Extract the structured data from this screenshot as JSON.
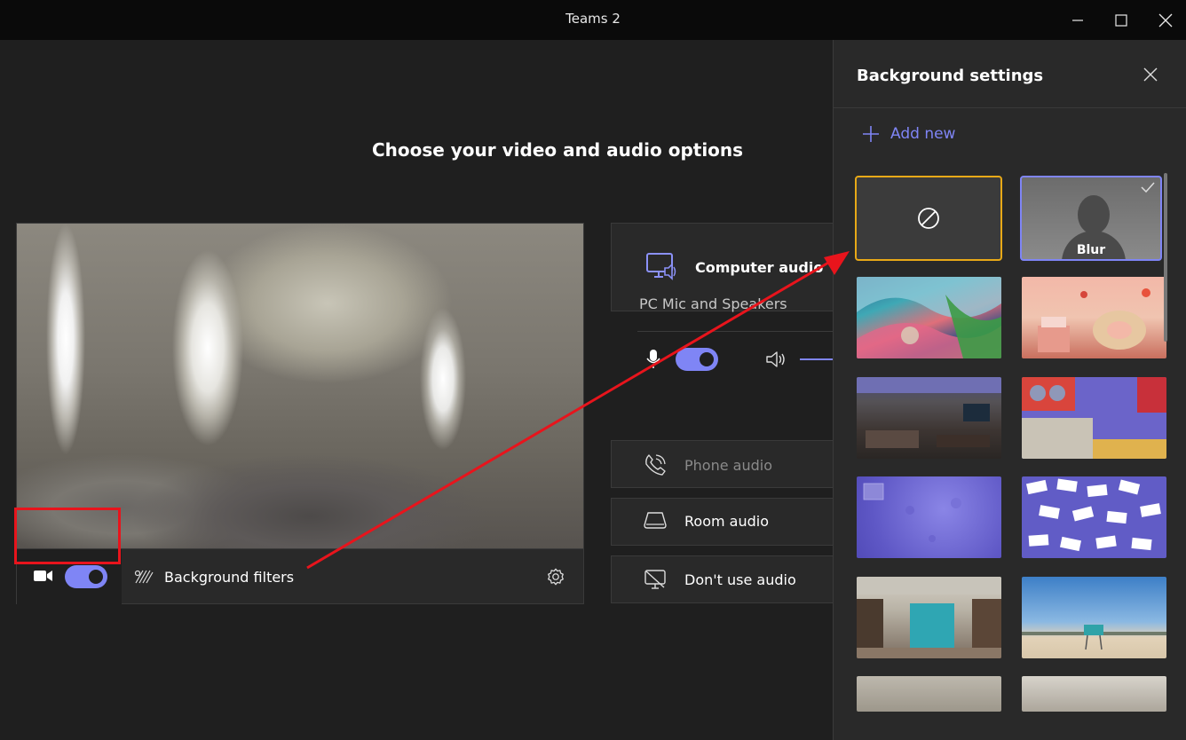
{
  "window": {
    "title": "Teams 2"
  },
  "main": {
    "heading": "Choose your video and audio options"
  },
  "video": {
    "camera_on": true,
    "background_filters_label": "Background filters"
  },
  "audio": {
    "computer_audio_label": "Computer audio",
    "device_label": "PC Mic and Speakers",
    "mic_on": true,
    "phone_audio_label": "Phone audio",
    "room_audio_label": "Room audio",
    "dont_use_audio_label": "Don't use audio"
  },
  "panel": {
    "title": "Background settings",
    "add_new_label": "Add new",
    "blur_label": "Blur",
    "selected": "none"
  },
  "colors": {
    "accent": "#7f85f5",
    "highlight_border": "#e8a917",
    "annotation_red": "#e8141c"
  }
}
